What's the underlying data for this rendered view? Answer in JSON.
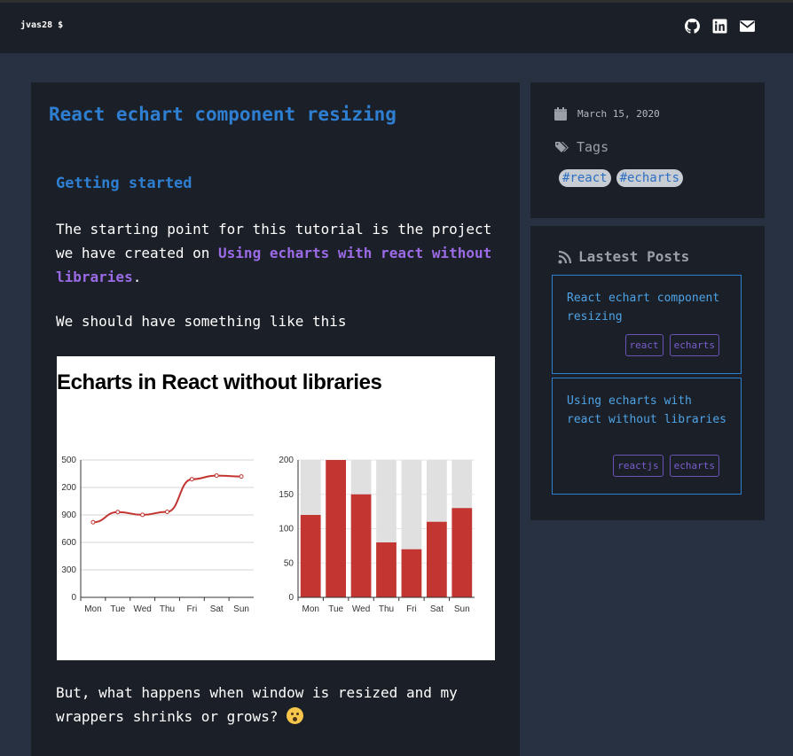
{
  "navbar": {
    "brand": "jvas28 $",
    "icons": [
      "github-icon",
      "linkedin-icon",
      "envelope-icon"
    ]
  },
  "post": {
    "title": "React echart component resizing",
    "section_heading": "Getting started",
    "p1_before": "The starting point for this tutorial is the project we have created on ",
    "p1_link": "Using echarts with react without libraries",
    "p1_after": ".",
    "p2": "We should have something like this",
    "p3": "But, what happens when window is resized and my wrappers shrinks or grows? ",
    "p3_emoji": "hushed-face-emoji"
  },
  "figure": {
    "title": "Echarts in React without libraries",
    "chart_data": [
      {
        "type": "line",
        "categories": [
          "Mon",
          "Tue",
          "Wed",
          "Thu",
          "Fri",
          "Sat",
          "Sun"
        ],
        "values": [
          820,
          932,
          901,
          934,
          1290,
          1330,
          1320
        ],
        "ytick_labels": [
          "0",
          "300",
          "600",
          "900",
          "200",
          "500"
        ],
        "color": "#c23531"
      },
      {
        "type": "bar",
        "categories": [
          "Mon",
          "Tue",
          "Wed",
          "Thu",
          "Fri",
          "Sat",
          "Sun"
        ],
        "values": [
          120,
          200,
          150,
          80,
          70,
          110,
          130
        ],
        "background_max": 200,
        "ylim": [
          0,
          200
        ],
        "yticks": [
          "0",
          "50",
          "100",
          "150",
          "200"
        ],
        "color": "#c23531",
        "background_color": "#e0e0e0"
      }
    ]
  },
  "sidebar": {
    "date": "March 15, 2020",
    "tags_label": "Tags",
    "tags": [
      "#react",
      "#echarts"
    ],
    "latest_title": "Lastest Posts",
    "latest_posts": [
      {
        "title": "React echart component resizing",
        "tags": [
          "react",
          "echarts"
        ]
      },
      {
        "title": "Using echarts with react without libraries",
        "tags": [
          "reactjs",
          "echarts"
        ]
      }
    ]
  }
}
